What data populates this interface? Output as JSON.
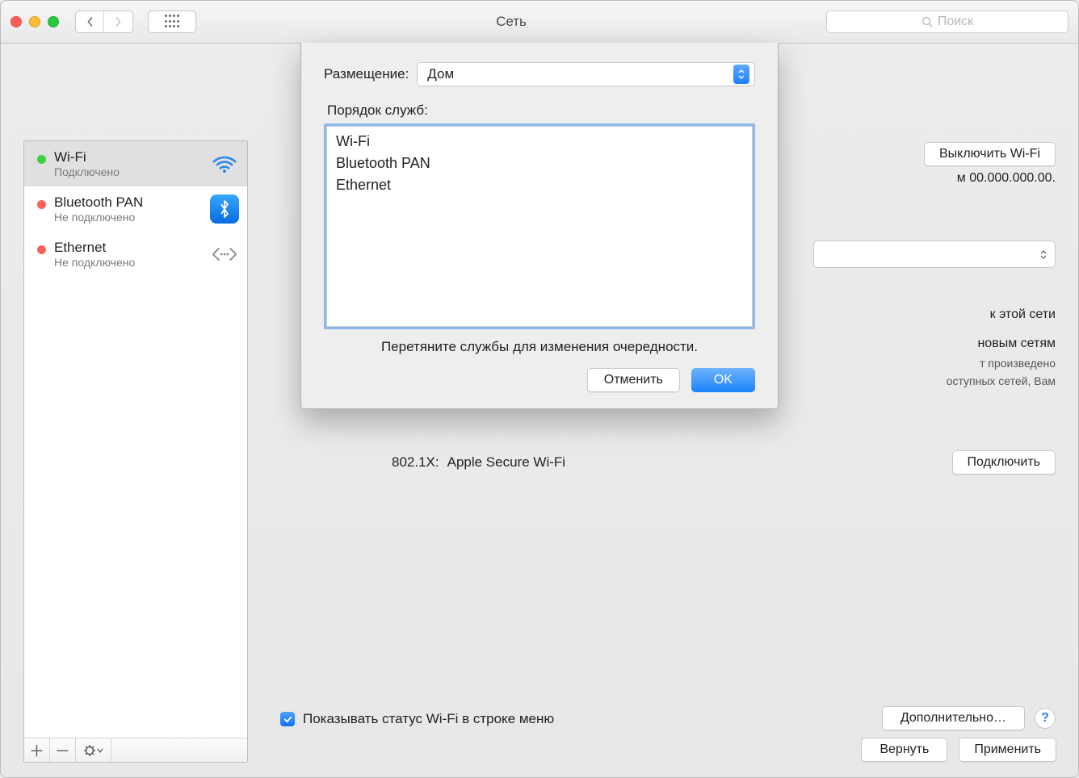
{
  "window": {
    "title": "Сеть"
  },
  "search": {
    "placeholder": "Поиск"
  },
  "sidebar": {
    "items": [
      {
        "name": "Wi-Fi",
        "status": "Подключено",
        "dot": "green",
        "icon": "wifi",
        "selected": true
      },
      {
        "name": "Bluetooth PAN",
        "status": "Не подключено",
        "dot": "red",
        "icon": "bluetooth",
        "selected": false
      },
      {
        "name": "Ethernet",
        "status": "Не подключено",
        "dot": "red",
        "icon": "ethernet",
        "selected": false
      }
    ]
  },
  "main": {
    "turn_off_wifi": "Выключить Wi-Fi",
    "ip_fragment": "м 00.000.000.00.",
    "partial_line1": "к этой сети",
    "partial_line2": "новым сетям",
    "partial_line3": "т произведено",
    "partial_line4": "оступных сетей, Вам",
    "x8021_label": "802.1X:",
    "x8021_value": "Apple Secure Wi-Fi",
    "connect": "Подключить",
    "show_status": "Показывать статус Wi-Fi в строке меню",
    "advanced": "Дополнительно…"
  },
  "footer": {
    "revert": "Вернуть",
    "apply": "Применить"
  },
  "sheet": {
    "location_label": "Размещение:",
    "location_value": "Дом",
    "order_label": "Порядок служб:",
    "services": [
      "Wi-Fi",
      "Bluetooth PAN",
      "Ethernet"
    ],
    "hint": "Перетяните службы для изменения очередности.",
    "cancel": "Отменить",
    "ok": "OK"
  }
}
